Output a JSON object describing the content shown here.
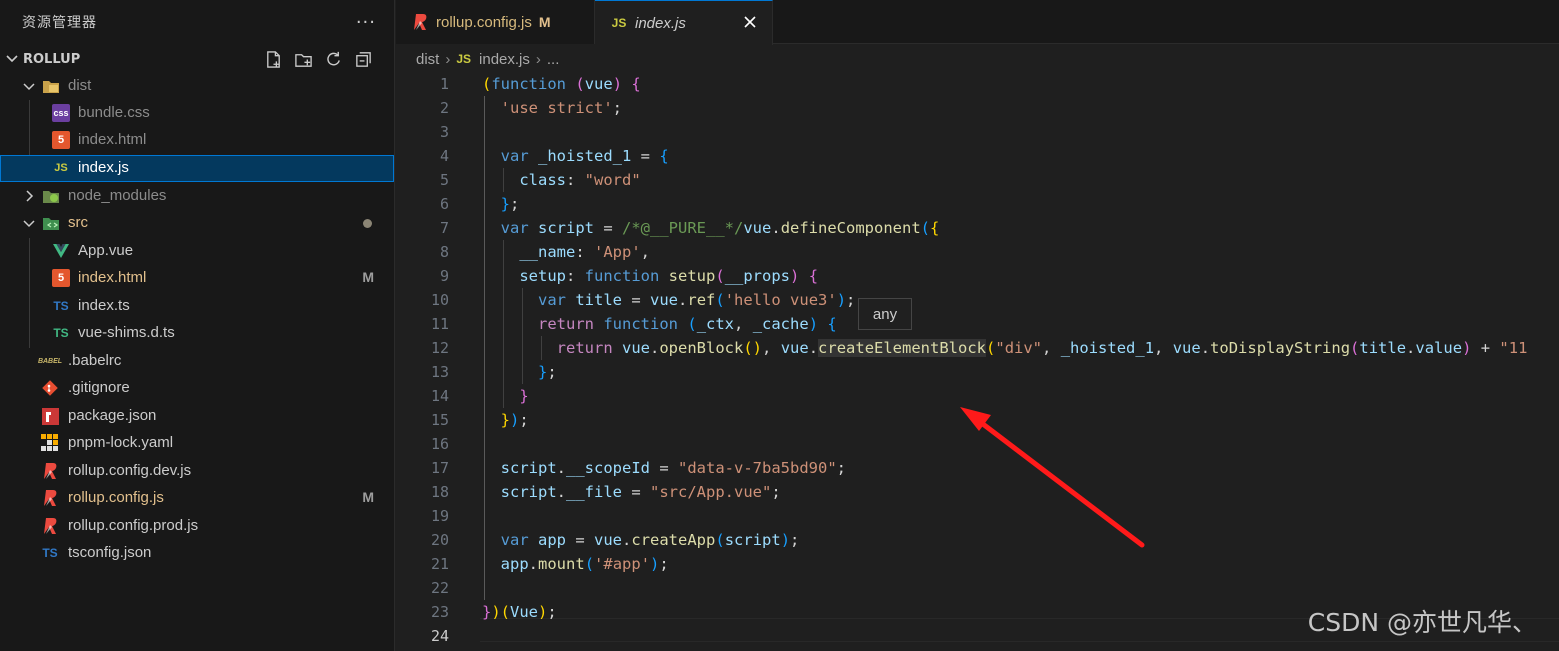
{
  "sidebar": {
    "title": "资源管理器",
    "more_label": "···",
    "project": "ROLLUP",
    "tree": [
      {
        "label": "dist",
        "icon": "folder-dist-icon",
        "kind": "folder-open"
      },
      {
        "label": "bundle.css",
        "icon": "css-file-icon",
        "kind": "file"
      },
      {
        "label": "index.html",
        "icon": "html-file-icon",
        "kind": "file"
      },
      {
        "label": "index.js",
        "icon": "js-file-icon",
        "kind": "file",
        "selected": true
      },
      {
        "label": "node_modules",
        "icon": "folder-node-icon",
        "kind": "folder-closed"
      },
      {
        "label": "src",
        "icon": "folder-src-icon",
        "kind": "folder-open",
        "status": "dot"
      },
      {
        "label": "App.vue",
        "icon": "vue-file-icon",
        "kind": "file"
      },
      {
        "label": "index.html",
        "icon": "html-file-icon",
        "kind": "file",
        "status": "M"
      },
      {
        "label": "index.ts",
        "icon": "ts-file-icon",
        "kind": "file"
      },
      {
        "label": "vue-shims.d.ts",
        "icon": "ts-def-file-icon",
        "kind": "file"
      },
      {
        "label": ".babelrc",
        "icon": "babel-file-icon",
        "kind": "file"
      },
      {
        "label": ".gitignore",
        "icon": "git-file-icon",
        "kind": "file"
      },
      {
        "label": "package.json",
        "icon": "npm-file-icon",
        "kind": "file"
      },
      {
        "label": "pnpm-lock.yaml",
        "icon": "pnpm-file-icon",
        "kind": "file"
      },
      {
        "label": "rollup.config.dev.js",
        "icon": "rollup-file-icon",
        "kind": "file"
      },
      {
        "label": "rollup.config.js",
        "icon": "rollup-file-icon",
        "kind": "file",
        "status": "M"
      },
      {
        "label": "rollup.config.prod.js",
        "icon": "rollup-file-icon",
        "kind": "file"
      },
      {
        "label": "tsconfig.json",
        "icon": "tsconfig-file-icon",
        "kind": "file"
      }
    ]
  },
  "tabs": [
    {
      "label": "rollup.config.js",
      "badge": "M",
      "icon": "rollup-file-icon"
    },
    {
      "label": "index.js",
      "icon": "js-file-icon",
      "icon_text": "JS",
      "active": true
    }
  ],
  "breadcrumb": {
    "folder": "dist",
    "file_icon": "JS",
    "file": "index.js",
    "tail": "..."
  },
  "editor": {
    "current_line": 24,
    "lines": [
      "1",
      "2",
      "3",
      "4",
      "5",
      "6",
      "7",
      "8",
      "9",
      "10",
      "11",
      "12",
      "13",
      "14",
      "15",
      "16",
      "17",
      "18",
      "19",
      "20",
      "21",
      "22",
      "23",
      "24"
    ]
  },
  "hover_tooltip": "any",
  "watermark": "CSDN @亦世凡华、",
  "icons": {
    "css": "css",
    "html": "5",
    "js": "JS",
    "ts": "TS",
    "babel": "BABEL"
  },
  "colors": {
    "accent": "#0078d4",
    "selection": "#04395e",
    "arrow": "#ff1a1a",
    "modified": "#e2c08d"
  }
}
